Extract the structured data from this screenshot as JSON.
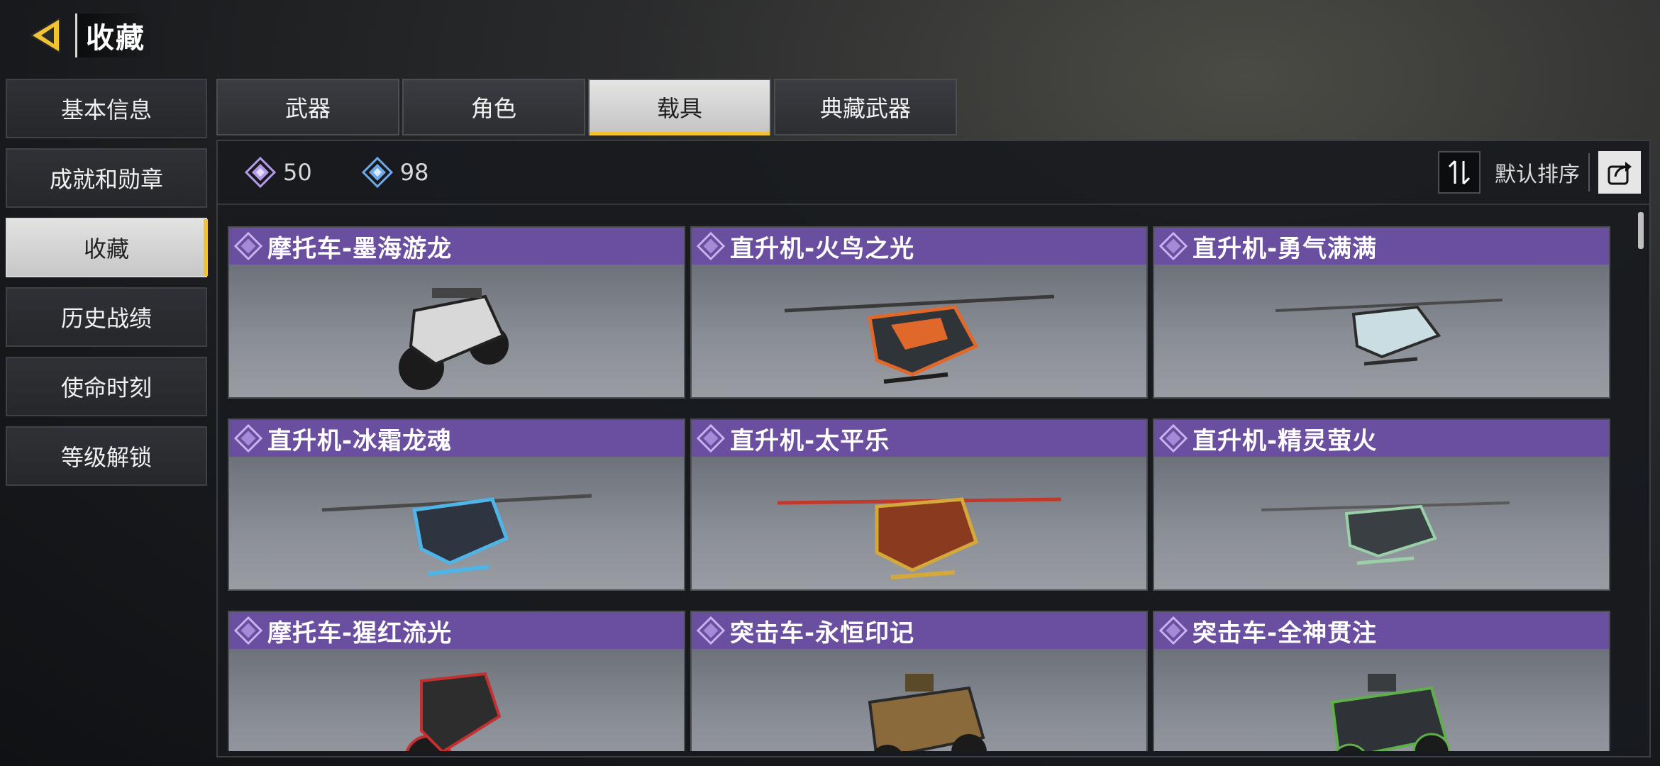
{
  "header": {
    "title": "收藏",
    "back_icon": "back-arrow-icon"
  },
  "sidebar": {
    "items": [
      {
        "label": "基本信息",
        "active": false
      },
      {
        "label": "成就和勋章",
        "active": false
      },
      {
        "label": "收藏",
        "active": true
      },
      {
        "label": "历史战绩",
        "active": false
      },
      {
        "label": "使命时刻",
        "active": false
      },
      {
        "label": "等级解锁",
        "active": false
      }
    ]
  },
  "tabs": [
    {
      "label": "武器",
      "active": false
    },
    {
      "label": "角色",
      "active": false
    },
    {
      "label": "载具",
      "active": true
    },
    {
      "label": "典藏武器",
      "active": false
    }
  ],
  "stats": {
    "purple_count": "50",
    "blue_count": "98"
  },
  "sort": {
    "label": "默认排序",
    "icon": "sort-toggle-icon",
    "share_icon": "share-icon"
  },
  "vehicles": [
    {
      "name": "摩托车-墨海游龙",
      "kind": "motorcycle",
      "color": "#d8d8d8"
    },
    {
      "name": "直升机-火鸟之光",
      "kind": "helicopter",
      "color": "#e0682a"
    },
    {
      "name": "直升机-勇气满满",
      "kind": "helicopter",
      "color": "#c9dde3"
    },
    {
      "name": "直升机-冰霜龙魂",
      "kind": "helicopter",
      "color": "#4fb4e6"
    },
    {
      "name": "直升机-太平乐",
      "kind": "helicopter",
      "color": "#c0392b"
    },
    {
      "name": "直升机-精灵萤火",
      "kind": "helicopter",
      "color": "#9ad0a8"
    },
    {
      "name": "摩托车-猩红流光",
      "kind": "motorcycle",
      "color": "#c23030"
    },
    {
      "name": "突击车-永恒印记",
      "kind": "buggy",
      "color": "#8a6a3a"
    },
    {
      "name": "突击车-全神贯注",
      "kind": "buggy",
      "color": "#5fb04a"
    }
  ],
  "colors": {
    "accent_yellow": "#f1c232",
    "card_title_purple": "#6a4fa0",
    "gem_purple": "#b59ae8",
    "gem_blue": "#6fa9e8"
  }
}
